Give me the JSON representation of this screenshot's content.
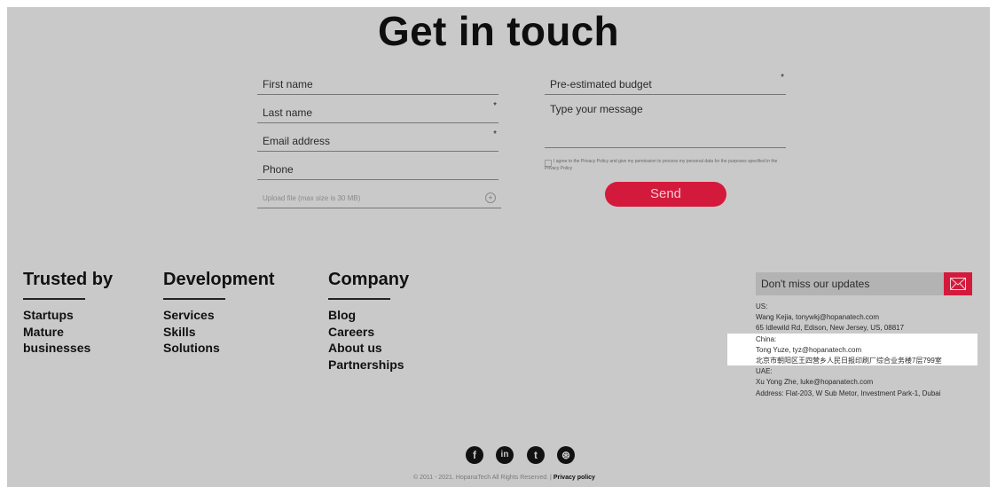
{
  "title": "Get in touch",
  "form": {
    "first_name_placeholder": "First name",
    "last_name_placeholder": "Last name",
    "email_placeholder": "Email address",
    "phone_placeholder": "Phone",
    "upload_placeholder": "Upload file (max size is 30 MB)",
    "budget_placeholder": "Pre-estimated budget",
    "message_placeholder": "Type your message",
    "required_mark": "*",
    "upload_icon": "plus-icon",
    "consent_text": "I agree to the Privacy Policy and give my permission to process my personal data for the purposes specified in the Privacy Policy",
    "send_label": "Send"
  },
  "footer": {
    "columns": [
      {
        "title": "Trusted by",
        "items": [
          "Startups",
          "Mature",
          "businesses"
        ]
      },
      {
        "title": "Development",
        "items": [
          "Services",
          "Skills",
          "Solutions"
        ]
      },
      {
        "title": "Company",
        "items": [
          "Blog",
          "Careers",
          "About us",
          "Partnerships"
        ]
      }
    ],
    "subscribe_placeholder": "Don't miss our updates",
    "contacts": [
      "US:",
      "Wang Kejia, tonywkj@hopanatech.com",
      "65 Idlewild Rd, Edison, New Jersey, US, 08817",
      "China:",
      "Tong Yuze, tyz@hopanatech.com",
      "北京市朝阳区王四营乡人民日报印刷厂综合业务楼7层799室",
      "UAE:",
      "Xu Yong Zhe, luke@hopanatech.com",
      "Address: Flat-203, W Sub Metor, Investment Park-1, Dubai"
    ],
    "social": [
      {
        "name": "facebook-icon",
        "glyph": "f"
      },
      {
        "name": "linkedin-icon",
        "glyph": "in"
      },
      {
        "name": "twitter-icon",
        "glyph": "t"
      },
      {
        "name": "dribbble-icon",
        "glyph": "⊛"
      }
    ],
    "copyright": "© 2011 - 2021. HopanaTech All Rights Reserved. |",
    "privacy_link": "Privacy policy"
  },
  "colors": {
    "accent": "#d41a3c",
    "background": "#c9c9c9"
  }
}
